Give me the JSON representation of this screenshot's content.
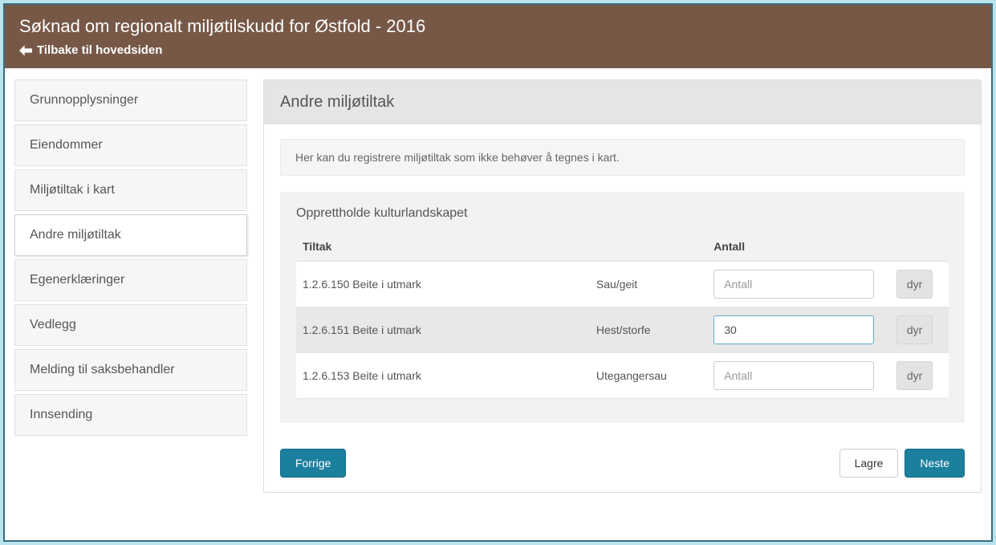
{
  "header": {
    "title": "Søknad om regionalt miljøtilskudd for Østfold - 2016",
    "back_label": "Tilbake til hovedsiden"
  },
  "sidebar": {
    "items": [
      {
        "label": "Grunnopplysninger",
        "active": false
      },
      {
        "label": "Eiendommer",
        "active": false
      },
      {
        "label": "Miljøtiltak i kart",
        "active": false
      },
      {
        "label": "Andre miljøtiltak",
        "active": true
      },
      {
        "label": "Egenerklæringer",
        "active": false
      },
      {
        "label": "Vedlegg",
        "active": false
      },
      {
        "label": "Melding til saksbehandler",
        "active": false
      },
      {
        "label": "Innsending",
        "active": false
      }
    ]
  },
  "main": {
    "title": "Andre miljøtiltak",
    "info_text": "Her kan du registrere miljøtiltak som ikke behøver å tegnes i kart.",
    "section": {
      "title": "Opprettholde kulturlandskapet",
      "headers": {
        "tiltak": "Tiltak",
        "antall": "Antall"
      },
      "placeholder_antall": "Antall",
      "rows": [
        {
          "tiltak": "1.2.6.150 Beite i utmark",
          "type": "Sau/geit",
          "value": "",
          "unit": "dyr"
        },
        {
          "tiltak": "1.2.6.151 Beite i utmark",
          "type": "Hest/storfe",
          "value": "30",
          "unit": "dyr"
        },
        {
          "tiltak": "1.2.6.153 Beite i utmark",
          "type": "Utegangersau",
          "value": "",
          "unit": "dyr"
        }
      ]
    }
  },
  "actions": {
    "prev": "Forrige",
    "save": "Lagre",
    "next": "Neste"
  }
}
